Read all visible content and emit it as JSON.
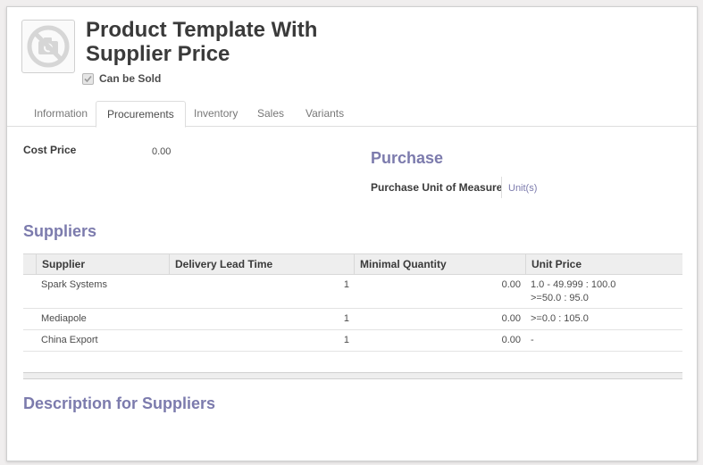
{
  "product": {
    "title_line1": "Product Template With",
    "title_line2": "Supplier Price",
    "can_be_sold_label": "Can be Sold",
    "can_be_sold": true,
    "image_icon": "camera-no-image-icon"
  },
  "tabs": [
    {
      "label": "Information",
      "active": false
    },
    {
      "label": "Procurements",
      "active": true
    },
    {
      "label": "Inventory",
      "active": false
    },
    {
      "label": "Sales",
      "active": false
    },
    {
      "label": "Variants",
      "active": false
    }
  ],
  "procurements": {
    "cost_price_label": "Cost Price",
    "cost_price_value": "0.00",
    "purchase_title": "Purchase",
    "purchase_uom_label": "Purchase Unit of Measure",
    "purchase_uom_value": "Unit(s)"
  },
  "suppliers": {
    "title": "Suppliers",
    "columns": [
      "Supplier",
      "Delivery Lead Time",
      "Minimal Quantity",
      "Unit Price"
    ],
    "rows": [
      {
        "supplier": "Spark Systems",
        "lead_time": "1",
        "min_qty": "0.00",
        "price_line1": "1.0 - 49.999 : 100.0",
        "price_line2": ">=50.0 : 95.0"
      },
      {
        "supplier": "Mediapole",
        "lead_time": "1",
        "min_qty": "0.00",
        "price_line1": ">=0.0 : 105.0",
        "price_line2": ""
      },
      {
        "supplier": "China Export",
        "lead_time": "1",
        "min_qty": "0.00",
        "price_line1": "-",
        "price_line2": ""
      }
    ]
  },
  "description": {
    "title": "Description for Suppliers"
  },
  "colors": {
    "accent": "#7c7bad",
    "text": "#4c4c4c",
    "heading": "#3a3a3a",
    "background": "#f0eeee"
  }
}
